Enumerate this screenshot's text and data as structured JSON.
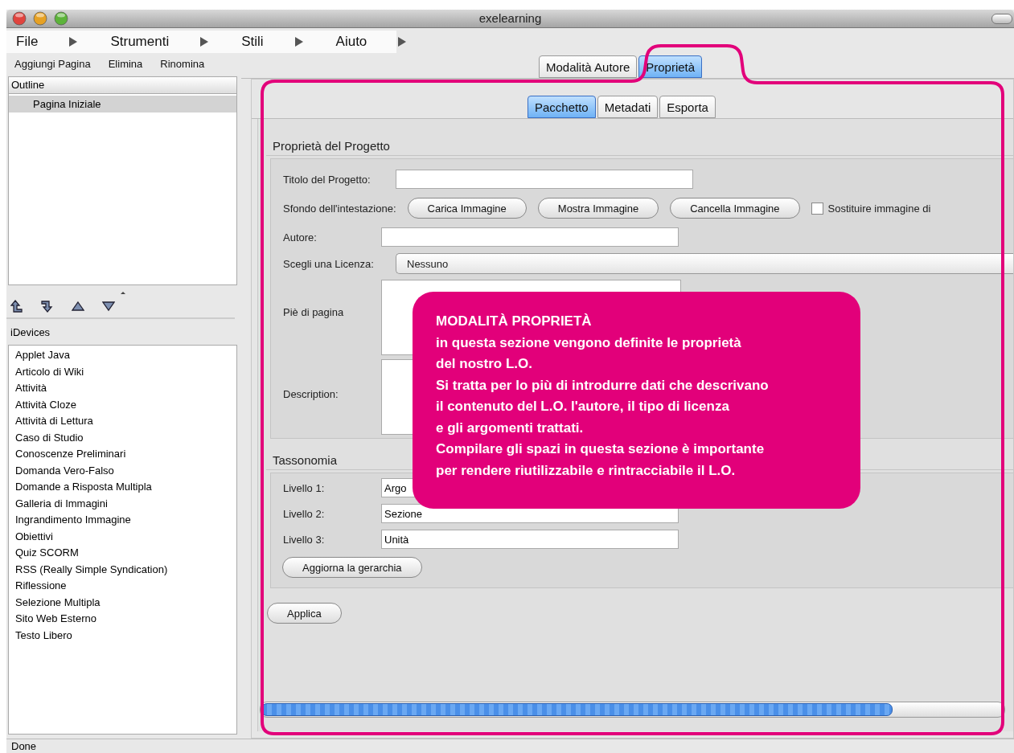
{
  "window": {
    "title": "exelearning"
  },
  "menu": [
    {
      "label": "File"
    },
    {
      "label": "Strumenti"
    },
    {
      "label": "Stili"
    },
    {
      "label": "Aiuto"
    }
  ],
  "outline_toolbar": [
    "Aggiungi Pagina",
    "Elimina",
    "Rinomina"
  ],
  "outline": {
    "header": "Outline",
    "items": [
      {
        "label": "Pagina Iniziale",
        "selected": true
      }
    ]
  },
  "idevices": {
    "title": "iDevices",
    "items": [
      "Applet Java",
      "Articolo di Wiki",
      "Attività",
      "Attività Cloze",
      "Attività di Lettura",
      "Caso di Studio",
      "Conoscenze Preliminari",
      "Domanda Vero-Falso",
      "Domande a Risposta Multipla",
      "Galleria di Immagini",
      "Ingrandimento Immagine",
      "Obiettivi",
      "Quiz SCORM",
      "RSS (Really Simple Syndication)",
      "Riflessione",
      "Selezione Multipla",
      "Sito Web Esterno",
      "Testo Libero"
    ]
  },
  "mode_tabs": [
    {
      "label": "Modalità Autore",
      "selected": false
    },
    {
      "label": "Proprietà",
      "selected": true
    }
  ],
  "sub_tabs": [
    {
      "label": "Pacchetto",
      "selected": true
    },
    {
      "label": "Metadati",
      "selected": false
    },
    {
      "label": "Esporta",
      "selected": false
    }
  ],
  "project": {
    "title": "Proprietà del Progetto",
    "fields": [
      {
        "kind": "text",
        "label": "Titolo del Progetto:"
      },
      {
        "kind": "buttons",
        "label": "Sfondo dell'intestazione:",
        "buttons": [
          "Carica Immagine",
          "Mostra Immagine",
          "Cancella Immagine"
        ],
        "checkbox": {
          "label": "Sostituire immagine di",
          "checked": false
        }
      },
      {
        "kind": "text",
        "label": "Autore:"
      },
      {
        "kind": "select",
        "label": "Scegli una Licenza:",
        "value": "Nessuno"
      },
      {
        "kind": "textarea",
        "label": "Piè di pagina"
      },
      {
        "kind": "textarea",
        "label": "Description:"
      }
    ]
  },
  "taxonomy": {
    "title": "Tassonomia",
    "levels": [
      {
        "label": "Livello 1:",
        "value": "Argo"
      },
      {
        "label": "Livello 2:",
        "value": "Sezione"
      },
      {
        "label": "Livello 3:",
        "value": "Unità"
      }
    ],
    "button": "Aggiorna la gerarchia"
  },
  "apply_button": "Applica",
  "callout": {
    "title": "MODALITÀ PROPRIETÀ",
    "text": "in questa sezione vengono definite le proprietà\ndel nostro L.O.\nSi tratta per lo più di introdurre dati che descrivano\nil contenuto del L.O. l'autore, il tipo di licenza\ne gli argomenti trattati.\nCompilare gli spazi in questa sezione è importante\nper rendere riutilizzabile e rintracciabile il L.O."
  },
  "status_bar": {
    "text": "Done"
  }
}
